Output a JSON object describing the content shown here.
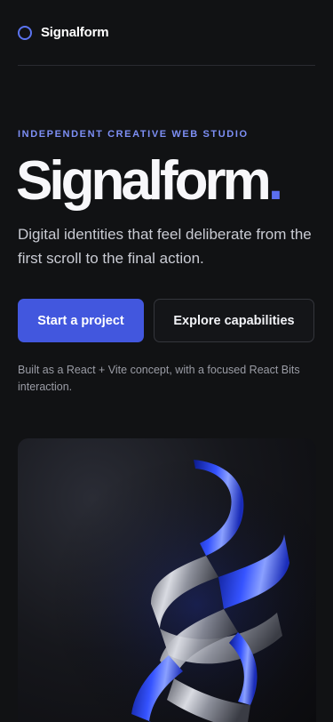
{
  "header": {
    "brand": "Signalform"
  },
  "hero": {
    "eyebrow": "INDEPENDENT CREATIVE WEB STUDIO",
    "title": "Signalform",
    "title_dot": ".",
    "lead": "Digital identities that feel deliberate from the first scroll to the final action.",
    "primary_cta": "Start a project",
    "secondary_cta": "Explore capabilities",
    "note": "Built as a React + Vite concept, with a focused React Bits interaction."
  },
  "colors": {
    "accent": "#4257de",
    "eyebrow": "#7d8ff5",
    "background": "#111214"
  },
  "icons": {
    "logo": "ring-logo-icon"
  }
}
